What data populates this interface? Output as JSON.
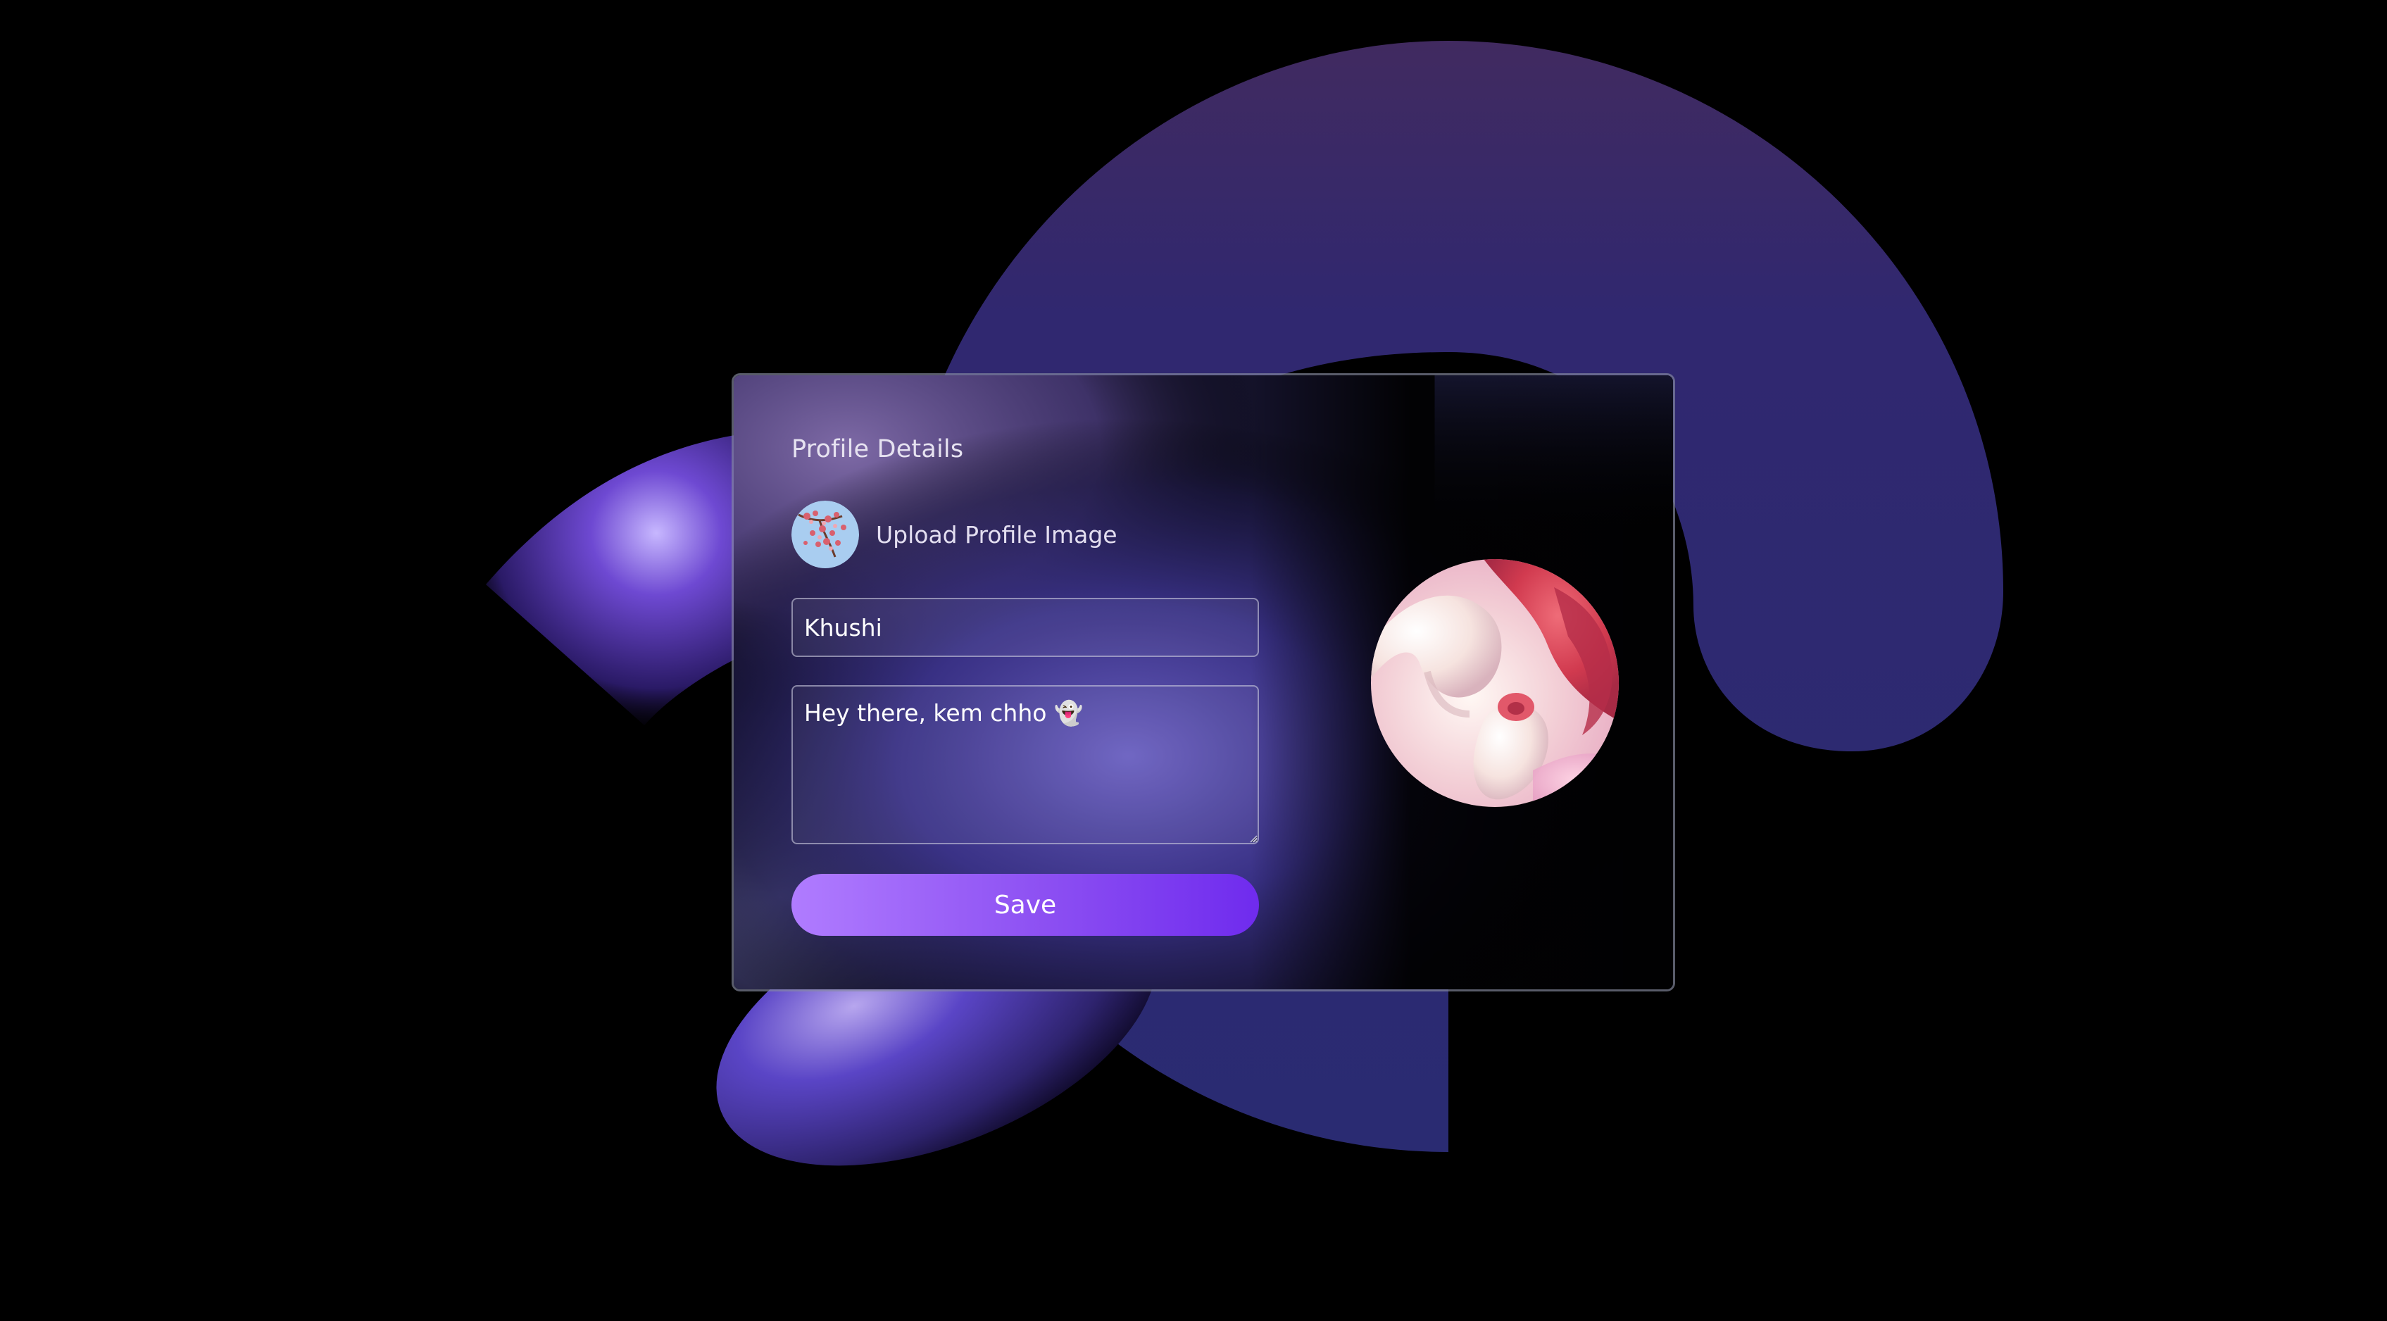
{
  "card": {
    "title": "Profile Details",
    "upload_label": "Upload Profile Image",
    "upload_avatar_icon": "cherry-blossom-avatar",
    "preview_image_icon": "abstract-3d-swirl-image"
  },
  "form": {
    "name_value": "Khushi",
    "bio_value": "Hey there, kem chho 👻",
    "save_label": "Save"
  },
  "colors": {
    "background": "#000000",
    "button_gradient_start": "#b07cff",
    "button_gradient_end": "#6f2bee",
    "shape_indigo": "#2b2b72",
    "shape_purple_top": "#3f2a63"
  }
}
